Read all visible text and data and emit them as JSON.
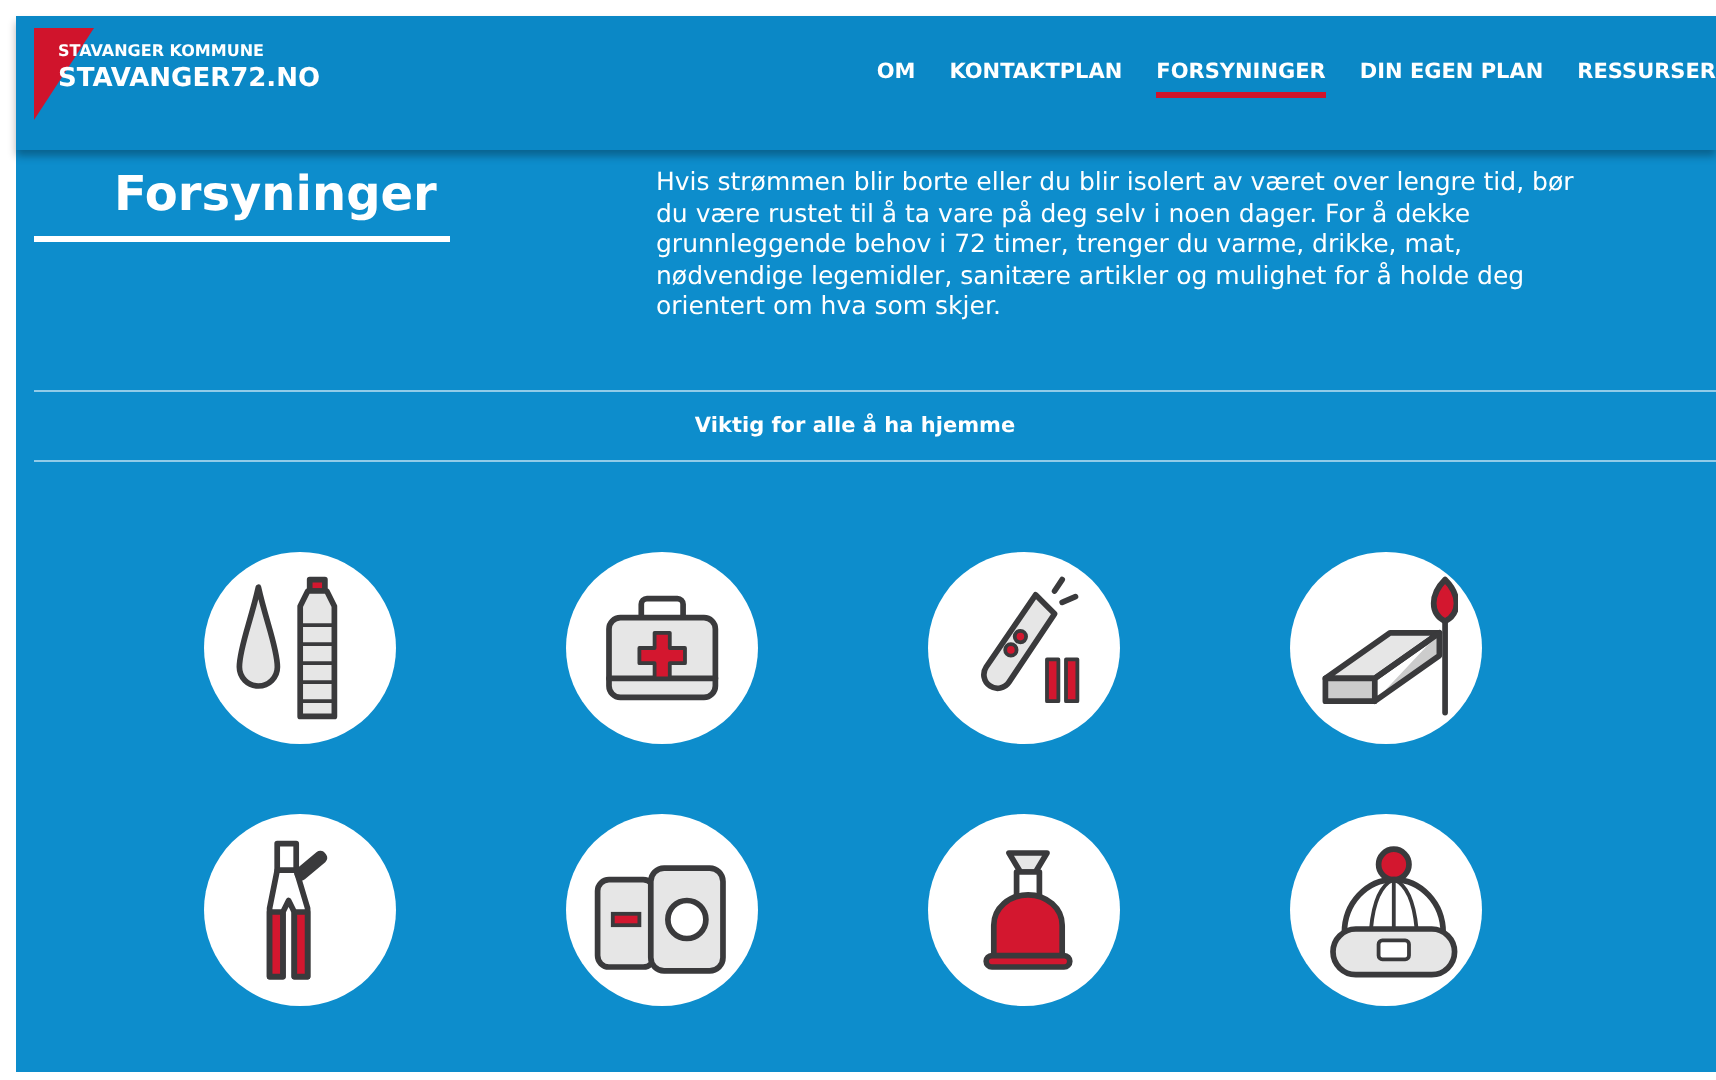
{
  "logo": {
    "org": "STAVANGER KOMMUNE",
    "site": "STAVANGER72.NO"
  },
  "nav": [
    {
      "label": "OM",
      "selected": false
    },
    {
      "label": "KONTAKTPLAN",
      "selected": false
    },
    {
      "label": "FORSYNINGER",
      "selected": true
    },
    {
      "label": "DIN EGEN PLAN",
      "selected": false
    },
    {
      "label": "RESSURSER",
      "selected": false
    }
  ],
  "page_title": "Forsyninger",
  "intro": "Hvis strømmen blir borte eller du blir isolert av været over lengre tid, bør du være rustet til å ta vare på deg selv i noen dager. For å dekke grunnleggende behov i 72 timer, trenger du varme, drikke, mat, nødvendige legemidler, sanitære artikler og mulighet for å holde deg orientert om hva som skjer.",
  "section_heading": "Viktig for alle å ha hjemme",
  "supplies": [
    {
      "kind": "water"
    },
    {
      "kind": "firstaid"
    },
    {
      "kind": "flashlight"
    },
    {
      "kind": "matches"
    },
    {
      "kind": "opener"
    },
    {
      "kind": "cans"
    },
    {
      "kind": "stove"
    },
    {
      "kind": "hat"
    }
  ]
}
